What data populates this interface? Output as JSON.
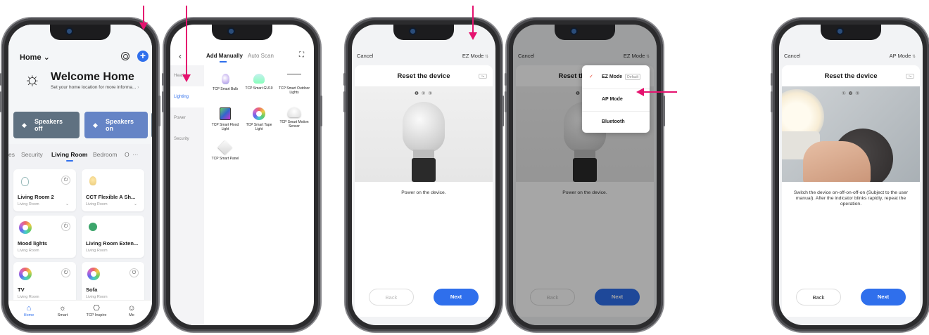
{
  "colors": {
    "accent": "#2f6fec",
    "annotation_arrow": "#e5136f",
    "checkmark": "#e8402a"
  },
  "screen_home": {
    "title": "Home ⌄",
    "welcome_title": "Welcome Home",
    "welcome_subtitle": "Set your home location for more informa...",
    "scenes": [
      {
        "label": "Speakers\noff",
        "color": "#5f7181"
      },
      {
        "label": "Speakers\non",
        "color": "#6584c6"
      }
    ],
    "tabs": [
      "es",
      "Security",
      "Living Room",
      "Bedroom",
      "O",
      "···"
    ],
    "active_tab": "Living Room",
    "devices": [
      {
        "name": "Living Room 2",
        "room": "Living Room",
        "icon": "bulb-outline-icon"
      },
      {
        "name": "CCT Flexible A Sh...",
        "room": "Living Room",
        "icon": "bulb-icon"
      },
      {
        "name": "Mood lights",
        "room": "Living Room",
        "icon": "rgb-ring-icon"
      },
      {
        "name": "Living Room Exten...",
        "room": "Living Room",
        "icon": "plug-icon"
      },
      {
        "name": "TV",
        "room": "Living Room",
        "icon": "rgb-ring-icon"
      },
      {
        "name": "Sofa",
        "room": "Living Room",
        "icon": "rgb-ring-icon"
      }
    ],
    "tabbar": [
      {
        "label": "Home",
        "glyph": "⌂"
      },
      {
        "label": "Smart",
        "glyph": "☼"
      },
      {
        "label": "TCP Inspire",
        "glyph": "⎔"
      },
      {
        "label": "Me",
        "glyph": "☺"
      }
    ]
  },
  "screen_add": {
    "back": "‹",
    "tab_manual": "Add Manually",
    "tab_scan": "Auto Scan",
    "scan_icon": "⛶",
    "categories": [
      "Heating",
      "Lighting",
      "Power",
      "Security"
    ],
    "active_category": "Lighting",
    "products": [
      "TCP Smart Bulb",
      "TCP Smart GU10",
      "TCP Smart Outdoor Lights",
      "TCP Smart Flood Light",
      "TCP Smart Tape Light",
      "TCP Smart Motion Sensor",
      "TCP Smart Panel"
    ]
  },
  "screen_reset": {
    "cancel": "Cancel",
    "mode_ez": "EZ Mode",
    "mode_ap": "AP Mode",
    "title": "Reset the device",
    "panel_menu_icon": "≡▾",
    "steps_a": "❶ ② ③",
    "steps_b": "① ❷ ③",
    "instruction_a": "Power on the device.",
    "instruction_b": "Switch the device on-off-on-off-on (Subject to the user manual). After the indicator blinks rapidly, repeat the operation.",
    "back": "Back",
    "next": "Next"
  },
  "mode_dropdown": {
    "items": [
      {
        "label": "EZ Mode",
        "badge": "Default",
        "checked": true
      },
      {
        "label": "AP Mode",
        "badge": "",
        "checked": false
      },
      {
        "label": "Bluetooth",
        "badge": "",
        "checked": false
      }
    ]
  }
}
